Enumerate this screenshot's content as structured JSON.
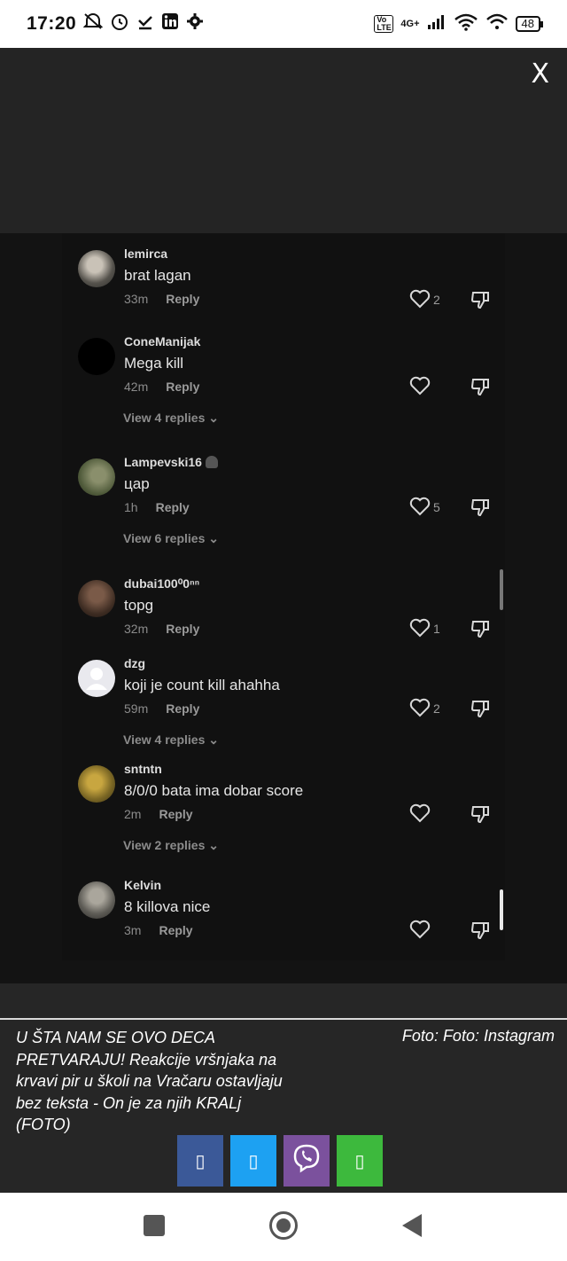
{
  "status_bar": {
    "time": "17:20",
    "network": "4G+",
    "volte": "Vo LTE",
    "battery": "48"
  },
  "viewer": {
    "close_label": "X"
  },
  "comments": [
    {
      "username": "lemirca",
      "text": "brat lagan",
      "time": "33m",
      "reply_label": "Reply",
      "likes": "2",
      "avatar_color": "#5a5a55"
    },
    {
      "username": "ConeManijak",
      "text": "Mega kill",
      "time": "42m",
      "reply_label": "Reply",
      "likes": "",
      "avatar_color": "#000000",
      "view_replies": "View 4 replies"
    },
    {
      "username": "Lampevski16",
      "text": "цар",
      "time": "1h",
      "reply_label": "Reply",
      "likes": "5",
      "avatar_color": "#5d6b48",
      "view_replies": "View 6 replies"
    },
    {
      "username": "dubai100⁰0ⁿⁿ",
      "text": "topg",
      "time": "32m",
      "reply_label": "Reply",
      "likes": "1",
      "avatar_color": "#4a3a30"
    },
    {
      "username": "dzg",
      "text": "koji je count kill ahahha",
      "time": "59m",
      "reply_label": "Reply",
      "likes": "2",
      "avatar_color": "#e9e9ee",
      "view_replies": "View 4 replies"
    },
    {
      "username": "sntntn",
      "text": "8/0/0 bata ima dobar score",
      "time": "2m",
      "reply_label": "Reply",
      "likes": "",
      "avatar_color": "#8a7a2a",
      "view_replies": "View 2 replies"
    },
    {
      "username": "Kelvin",
      "text": "8 killova nice",
      "time": "3m",
      "reply_label": "Reply",
      "likes": "",
      "avatar_color": "#6a6a66"
    }
  ],
  "caption": {
    "title": "U ŠTA NAM SE OVO DECA PRETVARAJU! Reakcije vršnjaka na krvavi pir u školi na Vračaru ostavljaju bez teksta - On je za njih KRALj (FOTO)",
    "credit": "Foto: Foto: Instagram"
  },
  "share_buttons": [
    {
      "name": "facebook",
      "glyph": "▯",
      "color": "#3b5998"
    },
    {
      "name": "twitter",
      "glyph": "▯",
      "color": "#1da1f2"
    },
    {
      "name": "viber",
      "glyph": "✆",
      "color": "#7b519d"
    },
    {
      "name": "whatsapp",
      "glyph": "▯",
      "color": "#3db93d"
    }
  ]
}
